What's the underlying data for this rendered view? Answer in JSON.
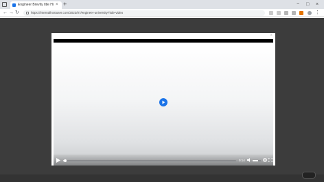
{
  "browser": {
    "tab_title": "Engineer Brevity title Hide",
    "tab_close": "×",
    "new_tab": "+",
    "window_controls": [
      "−",
      "□",
      "×"
    ],
    "url": "https://internalhostuser.com/2023/07/engineer-university-hide-video",
    "icons": [
      "window-icon",
      "back-arrow-icon",
      "forward-arrow-icon",
      "reload-icon",
      "lock-icon",
      "extension-icon",
      "profile-icon",
      "menu-icon"
    ]
  },
  "page": {
    "header_text": "",
    "header_right": ""
  },
  "modal": {
    "close_label": "×"
  },
  "video": {
    "time_label": "0:14",
    "progress_fraction": 0.01,
    "volume_fraction": 0.7,
    "accent_color": "#1a73e8"
  }
}
